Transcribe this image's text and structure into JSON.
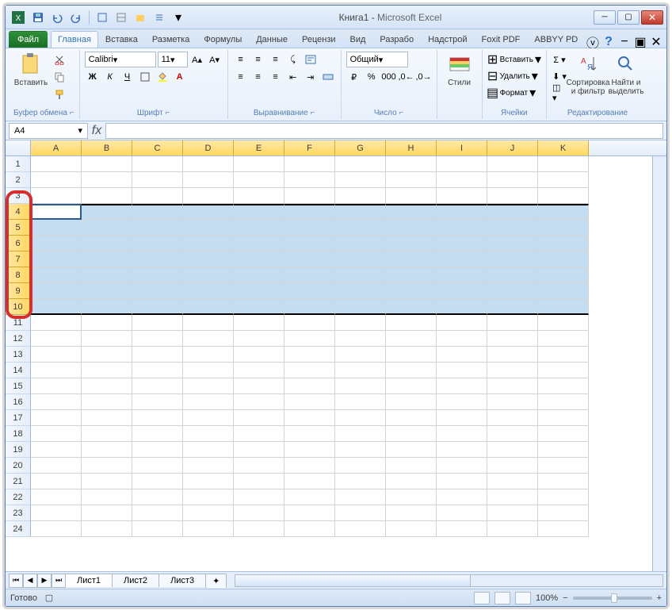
{
  "window": {
    "doc": "Книга1",
    "sep": " - ",
    "app": "Microsoft Excel"
  },
  "tabs": {
    "file": "Файл",
    "items": [
      "Главная",
      "Вставка",
      "Разметка",
      "Формулы",
      "Данные",
      "Рецензи",
      "Вид",
      "Разрабо",
      "Надстрой",
      "Foxit PDF",
      "ABBYY PD"
    ],
    "active": 0
  },
  "ribbon": {
    "clipboard": {
      "paste": "Вставить",
      "label": "Буфер обмена"
    },
    "font": {
      "name": "Calibri",
      "size": "11",
      "btns": {
        "bold": "Ж",
        "italic": "К",
        "underline": "Ч"
      },
      "label": "Шрифт"
    },
    "align": {
      "label": "Выравнивание"
    },
    "number": {
      "format": "Общий",
      "label": "Число"
    },
    "styles": {
      "btn": "Стили",
      "label": ""
    },
    "cells": {
      "insert": "Вставить",
      "delete": "Удалить",
      "format": "Формат",
      "label": "Ячейки"
    },
    "editing": {
      "sort": "Сортировка и фильтр",
      "find": "Найти и выделить",
      "label": "Редактирование"
    }
  },
  "fx": {
    "name": "A4",
    "fx": "fx"
  },
  "columns": [
    "A",
    "B",
    "C",
    "D",
    "E",
    "F",
    "G",
    "H",
    "I",
    "J",
    "K"
  ],
  "rows": [
    1,
    2,
    3,
    4,
    5,
    6,
    7,
    8,
    9,
    10,
    11,
    12,
    13,
    14,
    15,
    16,
    17,
    18,
    19,
    20,
    21,
    22,
    23,
    24
  ],
  "selection": {
    "start": 4,
    "end": 10,
    "active": "A4"
  },
  "sheets": {
    "items": [
      "Лист1",
      "Лист2",
      "Лист3"
    ],
    "active": 0
  },
  "status": {
    "ready": "Готово",
    "zoom": "100%",
    "minus": "−",
    "plus": "+"
  }
}
